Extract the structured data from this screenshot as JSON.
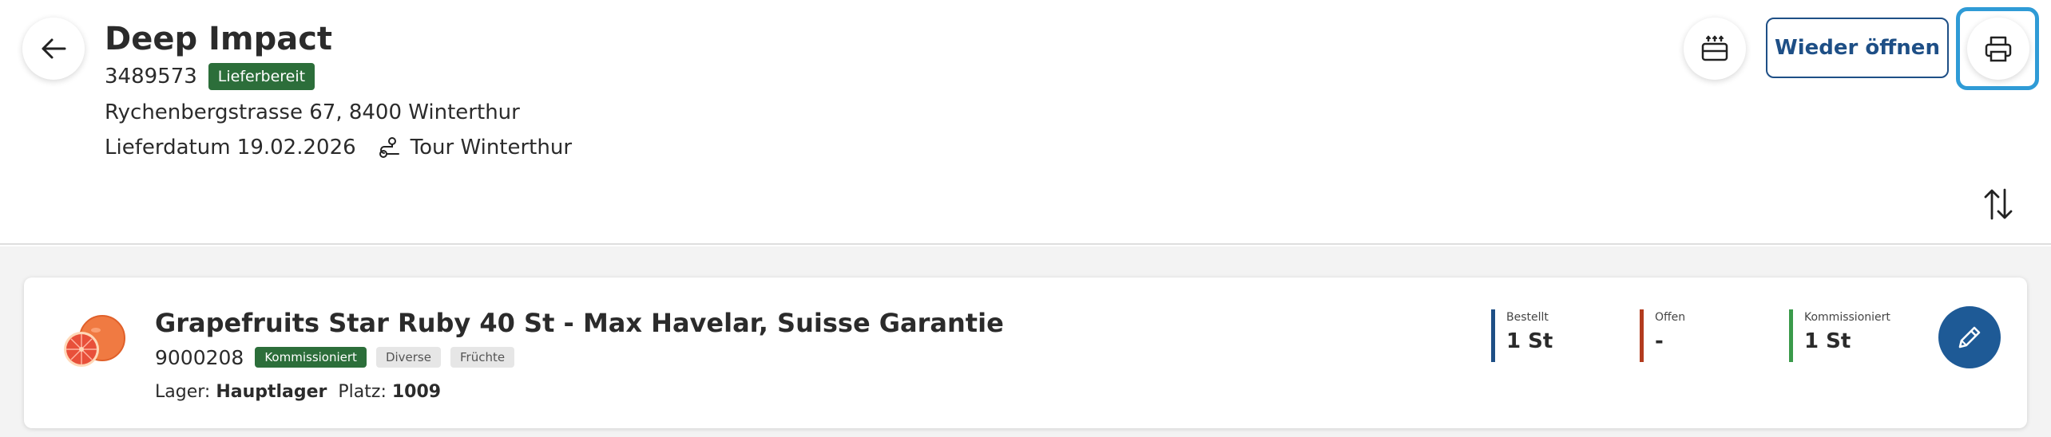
{
  "header": {
    "title": "Deep Impact",
    "order_number": "3489573",
    "status_badge": "Lieferbereit",
    "address": "Rychenbergstrasse 67, 8400 Winterthur",
    "delivery_date": "Lieferdatum 19.02.2026",
    "tour": "Tour Winterthur",
    "reopen_label": "Wieder öffnen",
    "icons": {
      "back": "arrow-left-icon",
      "delivery": "delivery-box-icon",
      "print": "printer-icon",
      "sort": "sort-arrows-icon",
      "tour": "route-icon"
    },
    "colors": {
      "status_green": "#2c6e3a",
      "primary_blue": "#1e4f86",
      "focus_ring": "#2f9bd6"
    }
  },
  "items": [
    {
      "title": "Grapefruits Star Ruby 40 St - Max Havelar, Suisse Garantie",
      "article_number": "9000208",
      "status_badge": "Kommissioniert",
      "tags": [
        "Diverse",
        "Früchte"
      ],
      "lager_label": "Lager:",
      "lager_value": "Hauptlager",
      "platz_label": "Platz:",
      "platz_value": "1009",
      "image": "grapefruit-image",
      "stats": [
        {
          "label": "Bestellt",
          "value": "1 St",
          "color": "#1e4f86"
        },
        {
          "label": "Offen",
          "value": "-",
          "color": "#b23b1e"
        },
        {
          "label": "Kommissioniert",
          "value": "1 St",
          "color": "#3a9a4a"
        }
      ],
      "edit_icon": "pencil-icon"
    }
  ]
}
